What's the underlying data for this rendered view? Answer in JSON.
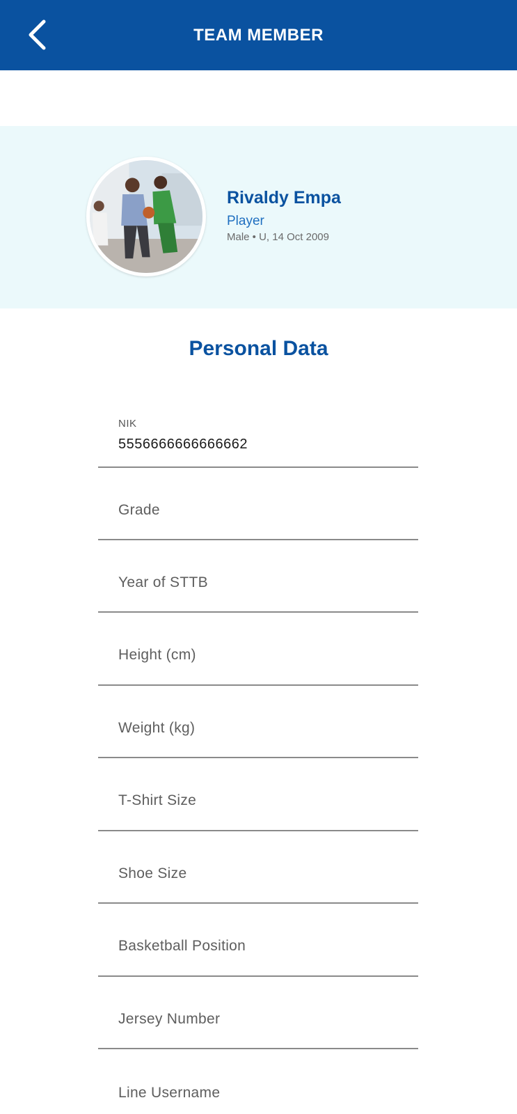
{
  "app_bar": {
    "title": "TEAM MEMBER",
    "back_icon": "chevron-left-icon",
    "color": "#0a52a0"
  },
  "profile": {
    "name": "Rivaldy Empa",
    "role": "Player",
    "meta": "Male • U, 14 Oct 2009",
    "avatar_alt": "basketball-players-photo"
  },
  "personal_data": {
    "title": "Personal Data",
    "fields": [
      {
        "label": "NIK",
        "value": "5556666666666662"
      },
      {
        "label": "Grade",
        "value": ""
      },
      {
        "label": "Year of STTB",
        "value": ""
      },
      {
        "label": "Height (cm)",
        "value": ""
      },
      {
        "label": "Weight (kg)",
        "value": ""
      },
      {
        "label": "T-Shirt Size",
        "value": ""
      },
      {
        "label": "Shoe Size",
        "value": ""
      },
      {
        "label": "Basketball Position",
        "value": ""
      },
      {
        "label": "Jersey Number",
        "value": ""
      },
      {
        "label": "Line Username",
        "value": ""
      }
    ]
  }
}
